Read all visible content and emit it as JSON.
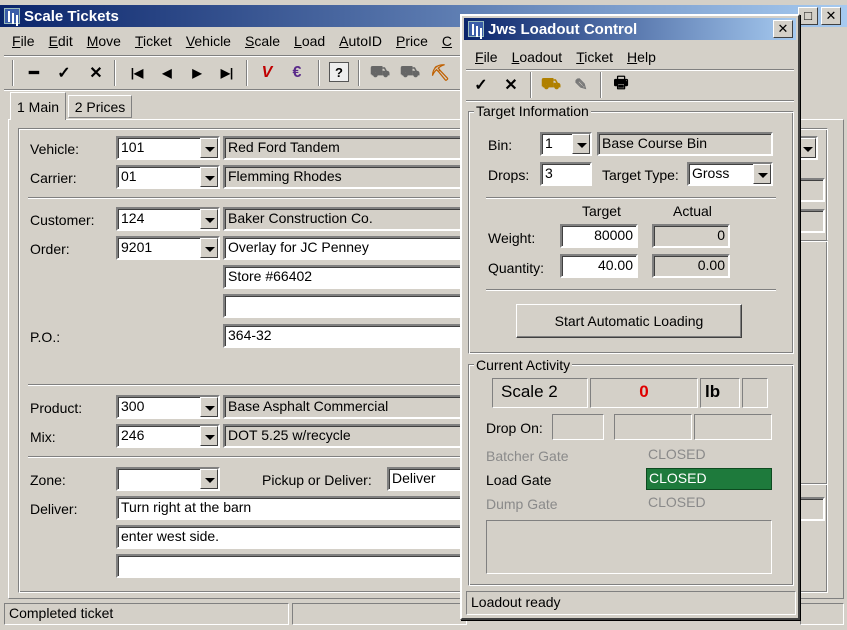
{
  "main_window": {
    "title": "Scale Tickets",
    "menu": [
      "File",
      "Edit",
      "Move",
      "Ticket",
      "Vehicle",
      "Scale",
      "Load",
      "AutoID",
      "Price",
      "C"
    ],
    "tabs": [
      "1 Main",
      "2 Prices"
    ],
    "vehicle": {
      "label": "Vehicle:",
      "value": "101",
      "desc": "Red Ford Tandem"
    },
    "carrier": {
      "label": "Carrier:",
      "value": "01",
      "desc": "Flemming Rhodes"
    },
    "customer": {
      "label": "Customer:",
      "value": "124",
      "desc": "Baker Construction Co."
    },
    "order": {
      "label": "Order:",
      "value": "9201",
      "desc": "Overlay for JC Penney",
      "line2": "Store #66402",
      "line3": ""
    },
    "po": {
      "label": "P.O.:",
      "value": "364-32"
    },
    "product": {
      "label": "Product:",
      "value": "300",
      "desc": "Base Asphalt Commercial"
    },
    "mix": {
      "label": "Mix:",
      "value": "246",
      "desc": "DOT 5.25 w/recycle"
    },
    "zone": {
      "label": "Zone:",
      "value": ""
    },
    "pickup": {
      "label": "Pickup or Deliver:",
      "value": "Deliver"
    },
    "deliver": {
      "label": "Deliver:",
      "line1": "Turn right at the barn",
      "line2": "enter west side.",
      "line3": ""
    },
    "status": "Completed ticket"
  },
  "loadout": {
    "title": "Jws Loadout Control",
    "menu": [
      "File",
      "Loadout",
      "Ticket",
      "Help"
    ],
    "target_info": "Target Information",
    "bin_label": "Bin:",
    "bin_value": "1",
    "bin_desc": "Base Course Bin",
    "drops_label": "Drops:",
    "drops_value": "3",
    "target_type_label": "Target Type:",
    "target_type_value": "Gross",
    "col_target": "Target",
    "col_actual": "Actual",
    "weight_label": "Weight:",
    "weight_target": "80000",
    "weight_actual": "0",
    "quantity_label": "Quantity:",
    "quantity_target": "40.00",
    "quantity_actual": "0.00",
    "start_button": "Start Automatic Loading",
    "current_activity": "Current Activity",
    "scale_name": "Scale 2",
    "scale_reading": "0",
    "scale_unit": "lb",
    "drop_on_label": "Drop On:",
    "gates": [
      {
        "label": "Batcher Gate",
        "state": "CLOSED",
        "active": false
      },
      {
        "label": "Load Gate",
        "state": "CLOSED",
        "active": true
      },
      {
        "label": "Dump Gate",
        "state": "CLOSED",
        "active": false
      }
    ],
    "status": "Loadout ready",
    "colors": {
      "active_gate": "#1e7a3c",
      "reading": "#e00000"
    }
  }
}
